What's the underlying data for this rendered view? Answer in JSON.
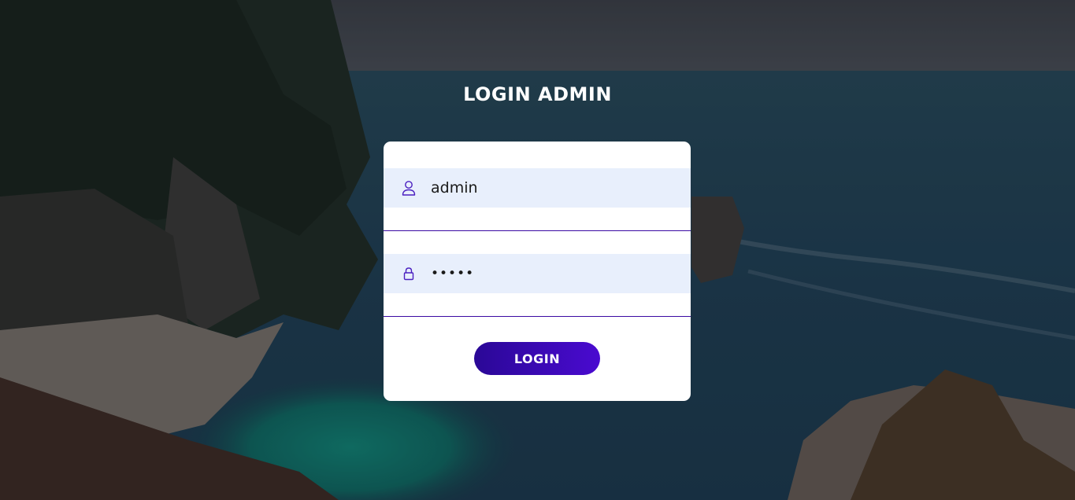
{
  "page": {
    "title": "LOGIN ADMIN"
  },
  "form": {
    "username": {
      "value": "admin",
      "icon": "user-icon"
    },
    "password": {
      "value": "•••••",
      "icon": "lock-icon"
    },
    "login_label": "LOGIN"
  },
  "colors": {
    "accent_start": "#2a0896",
    "accent_end": "#4a0ad0",
    "field_bg": "#e8effc",
    "underline": "#3a0aa3",
    "icon": "#4a1fc0"
  }
}
